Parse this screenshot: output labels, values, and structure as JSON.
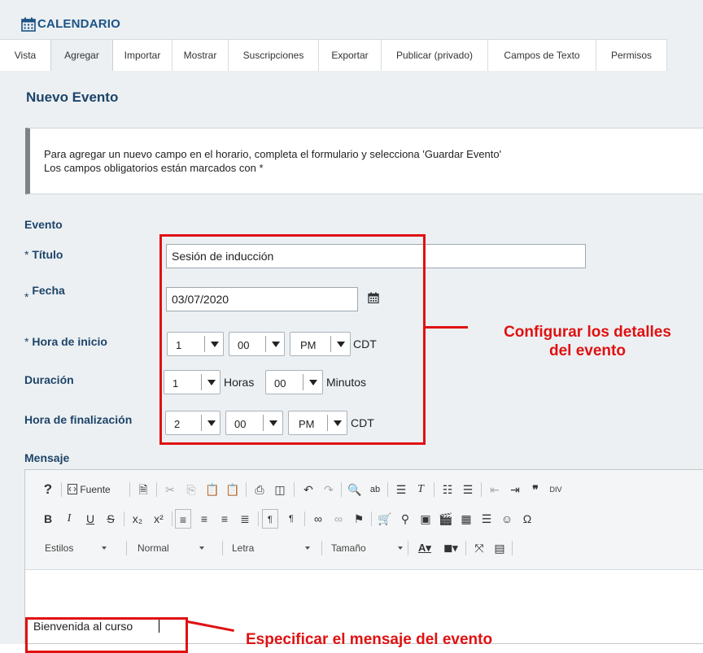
{
  "app": {
    "title": "CALENDARIO"
  },
  "tabs": [
    {
      "label": "Vista"
    },
    {
      "label": "Agregar"
    },
    {
      "label": "Importar"
    },
    {
      "label": "Mostrar"
    },
    {
      "label": "Suscripciones"
    },
    {
      "label": "Exportar"
    },
    {
      "label": "Publicar (privado)"
    },
    {
      "label": "Campos de Texto"
    },
    {
      "label": "Permisos"
    }
  ],
  "active_tab": "Agregar",
  "page": {
    "title": "Nuevo Evento"
  },
  "info": {
    "line1": "Para agregar un nuevo campo en el horario, completa el formulario y selecciona 'Guardar Evento'",
    "line2": "Los campos obligatorios están marcados con *"
  },
  "form": {
    "section": "Evento",
    "required_mark": "*",
    "title_label": "Título",
    "title_value": "Sesión de inducción",
    "date_label": "Fecha",
    "date_value": "03/07/2020",
    "start_label": "Hora de inicio",
    "start_hour": "1",
    "start_minute": "00",
    "start_ampm": "PM",
    "start_tz": "CDT",
    "duration_label": "Duración",
    "duration_hours": "1",
    "duration_hours_unit": "Horas",
    "duration_minutes": "00",
    "duration_minutes_unit": "Minutos",
    "end_label": "Hora de finalización",
    "end_hour": "2",
    "end_minute": "00",
    "end_ampm": "PM",
    "end_tz": "CDT",
    "message_label": "Mensaje"
  },
  "editor": {
    "source_label": "Fuente",
    "styles": "Estilos",
    "format": "Normal",
    "font": "Letra",
    "size": "Tamaño",
    "content": "Bienvenida al curso"
  },
  "annotations": {
    "details_line1": "Configurar los detalles",
    "details_line2": "del evento",
    "message": "Especificar el mensaje del evento"
  },
  "colors": {
    "accent": "#1c5385",
    "annotation": "#e01111",
    "background": "#ecf0f3"
  }
}
